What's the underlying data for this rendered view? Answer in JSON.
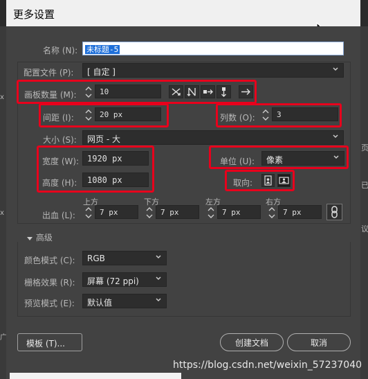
{
  "dialog": {
    "title": "更多设置",
    "name_label": "名称 (N):",
    "name_value": "未标题-5",
    "profile_label": "配置文件 (P):",
    "profile_value": "[ 自定 ]",
    "artboards_label": "画板数量 (M):",
    "artboards_value": "10",
    "spacing_label": "间距 (I):",
    "spacing_value": "20 px",
    "columns_label": "列数 (O):",
    "columns_value": "3",
    "size_label": "大小 (S):",
    "size_value": "网页 - 大",
    "width_label": "宽度 (W):",
    "width_value": "1920 px",
    "height_label": "高度 (H):",
    "height_value": "1080 px",
    "units_label": "单位 (U):",
    "units_value": "像素",
    "orientation_label": "取向:",
    "bleed_label": "出血 (L):",
    "bleed": {
      "top_label": "上方",
      "top": "7 px",
      "bottom_label": "下方",
      "bottom": "7 px",
      "left_label": "左方",
      "left": "7 px",
      "right_label": "右方",
      "right": "7 px"
    },
    "advanced_label": "高级",
    "color_mode_label": "颜色模式 (C):",
    "color_mode_value": "RGB",
    "raster_label": "栅格效果 (R):",
    "raster_value": "屏幕 (72 ppi)",
    "preview_label": "预览模式 (E):",
    "preview_value": "默认值",
    "templates_button": "模板 (T)...",
    "create_button": "创建文档",
    "cancel_button": "取消"
  },
  "background": {
    "right_glyphs": [
      "页",
      "已",
      "议"
    ],
    "left_glyphs": [
      "x",
      "x",
      "广"
    ]
  },
  "watermark": "https://blog.csdn.net/weixin_57237040",
  "colors": {
    "highlight": "#e8001c",
    "dialog_bg": "#424242",
    "field_bg": "#2d2d2d",
    "selection": "#1e6fd9"
  }
}
